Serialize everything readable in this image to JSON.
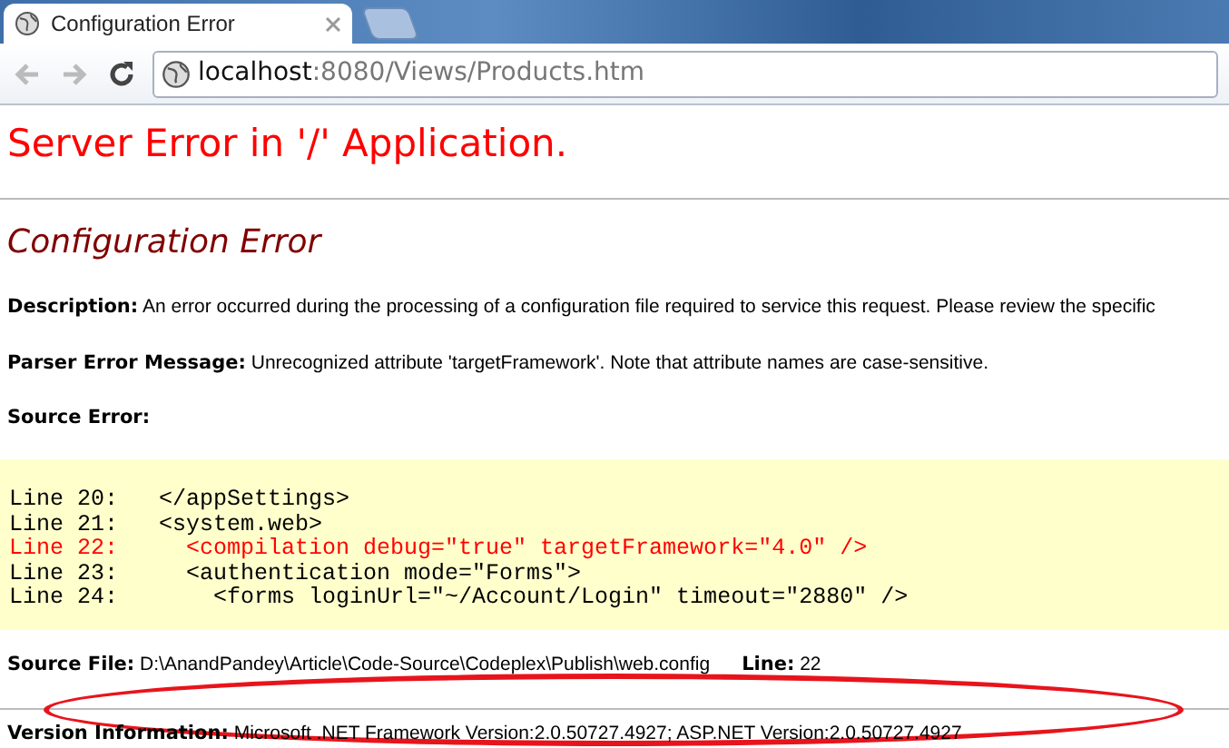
{
  "browser": {
    "tab": {
      "title": "Configuration Error",
      "selected": true
    },
    "address": {
      "host": "localhost",
      "path": ":8080/Views/Products.htm"
    }
  },
  "page": {
    "heading": "Server Error in '/' Application.",
    "subheading": "Configuration Error",
    "description": {
      "label": "Description:",
      "text": "An error occurred during the processing of a configuration file required to service this request. Please review the specific"
    },
    "parser_error": {
      "label": "Parser Error Message:",
      "text": "Unrecognized attribute 'targetFramework'. Note that attribute names are case-sensitive."
    },
    "source_error": {
      "label": "Source Error:"
    },
    "source_lines": [
      {
        "text": "Line 20:   </appSettings>",
        "highlighted": false
      },
      {
        "text": "Line 21:   <system.web>",
        "highlighted": false
      },
      {
        "text": "Line 22:     <compilation debug=\"true\" targetFramework=\"4.0\" />",
        "highlighted": true
      },
      {
        "text": "Line 23:     <authentication mode=\"Forms\">",
        "highlighted": false
      },
      {
        "text": "Line 24:       <forms loginUrl=\"~/Account/Login\" timeout=\"2880\" />",
        "highlighted": false
      }
    ],
    "source_file": {
      "label": "Source File:",
      "path": "D:\\AnandPandey\\Article\\Code-Source\\Codeplex\\Publish\\web.config",
      "line_label": "Line:",
      "line": "22"
    },
    "version": {
      "label": "Version Information:",
      "text": "Microsoft .NET Framework Version:2.0.50727.4927; ASP.NET Version:2.0.50727.4927"
    }
  }
}
